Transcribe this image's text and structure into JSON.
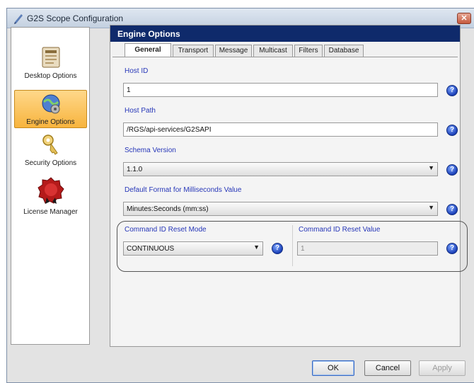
{
  "window": {
    "title": "G2S Scope Configuration",
    "close_glyph": "✕"
  },
  "sidebar": {
    "items": [
      {
        "label": "Desktop Options",
        "icon": "desktop-settings-icon",
        "selected": false
      },
      {
        "label": "Engine Options",
        "icon": "engine-globe-icon",
        "selected": true
      },
      {
        "label": "Security Options",
        "icon": "key-icon",
        "selected": false
      },
      {
        "label": "License Manager",
        "icon": "license-seal-icon",
        "selected": false
      }
    ]
  },
  "header": {
    "title": "Engine Options"
  },
  "tabs": [
    {
      "label": "General",
      "active": true
    },
    {
      "label": "Transport",
      "active": false
    },
    {
      "label": "Message",
      "active": false
    },
    {
      "label": "Multicast",
      "active": false
    },
    {
      "label": "Filters",
      "active": false
    },
    {
      "label": "Database",
      "active": false
    }
  ],
  "fields": {
    "host_id": {
      "label": "Host ID",
      "value": "1"
    },
    "host_path": {
      "label": "Host Path",
      "value": "/RGS/api-services/G2SAPI"
    },
    "schema_version": {
      "label": "Schema Version",
      "value": "1.1.0"
    },
    "ms_format": {
      "label": "Default Format for Milliseconds Value",
      "value": "Minutes:Seconds (mm:ss)"
    },
    "reset_mode": {
      "label": "Command ID Reset Mode",
      "value": "CONTINUOUS"
    },
    "reset_value": {
      "label": "Command ID Reset Value",
      "value": "1"
    }
  },
  "help_glyph": "?",
  "combo_arrow": "▼",
  "buttons": {
    "ok": "OK",
    "cancel": "Cancel",
    "apply": "Apply"
  },
  "colors": {
    "header_bg": "#0f2a6b",
    "label_blue": "#2636b8",
    "selected_item": "#f7b43e",
    "help_icon": "#1a3fb7"
  }
}
